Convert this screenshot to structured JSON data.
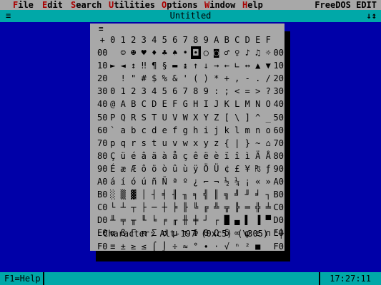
{
  "menu": {
    "items": [
      {
        "hot": "F",
        "rest": "ile"
      },
      {
        "hot": "E",
        "rest": "dit"
      },
      {
        "hot": "S",
        "rest": "earch"
      },
      {
        "hot": "U",
        "rest": "tilities"
      },
      {
        "hot": "O",
        "rest": "ptions"
      },
      {
        "hot": "W",
        "rest": "indow"
      },
      {
        "hot": "H",
        "rest": "elp"
      }
    ],
    "app_name": "FreeDOS EDIT"
  },
  "window": {
    "title": "Untitled",
    "system_box": "≡",
    "scroll_arrows": "↓↕"
  },
  "ascii_dialog": {
    "close_box": "≡",
    "header_row": [
      "+",
      "0",
      "1",
      "2",
      "3",
      "4",
      "5",
      "6",
      "7",
      "8",
      "9",
      "A",
      "B",
      "C",
      "D",
      "E",
      "F"
    ],
    "rows": [
      [
        "00",
        "",
        "☺",
        "☻",
        "♥",
        "♦",
        "♣",
        "♠",
        "•",
        "◘",
        "○",
        "◙",
        "♂",
        "♀",
        "♪",
        "♫",
        "☼"
      ],
      [
        "10",
        "►",
        "◄",
        "↕",
        "‼",
        "¶",
        "§",
        "▬",
        "↨",
        "↑",
        "↓",
        "→",
        "←",
        "∟",
        "↔",
        "▲",
        "▼"
      ],
      [
        "20",
        " ",
        "!",
        "\"",
        "#",
        "$",
        "%",
        "&",
        "'",
        "(",
        ")",
        "*",
        "+",
        ",",
        "-",
        ".",
        "/"
      ],
      [
        "30",
        "0",
        "1",
        "2",
        "3",
        "4",
        "5",
        "6",
        "7",
        "8",
        "9",
        ":",
        ";",
        "<",
        "=",
        ">",
        "?"
      ],
      [
        "40",
        "@",
        "A",
        "B",
        "C",
        "D",
        "E",
        "F",
        "G",
        "H",
        "I",
        "J",
        "K",
        "L",
        "M",
        "N",
        "O"
      ],
      [
        "50",
        "P",
        "Q",
        "R",
        "S",
        "T",
        "U",
        "V",
        "W",
        "X",
        "Y",
        "Z",
        "[",
        "\\",
        "]",
        "^",
        "_"
      ],
      [
        "60",
        "`",
        "a",
        "b",
        "c",
        "d",
        "e",
        "f",
        "g",
        "h",
        "i",
        "j",
        "k",
        "l",
        "m",
        "n",
        "o"
      ],
      [
        "70",
        "p",
        "q",
        "r",
        "s",
        "t",
        "u",
        "v",
        "w",
        "x",
        "y",
        "z",
        "{",
        "|",
        "}",
        "~",
        "⌂"
      ],
      [
        "80",
        "Ç",
        "ü",
        "é",
        "â",
        "ä",
        "à",
        "å",
        "ç",
        "ê",
        "ë",
        "è",
        "ï",
        "î",
        "ì",
        "Ä",
        "Å"
      ],
      [
        "90",
        "É",
        "æ",
        "Æ",
        "ô",
        "ö",
        "ò",
        "û",
        "ù",
        "ÿ",
        "Ö",
        "Ü",
        "¢",
        "£",
        "¥",
        "₧",
        "ƒ"
      ],
      [
        "A0",
        "á",
        "í",
        "ó",
        "ú",
        "ñ",
        "Ñ",
        "ª",
        "º",
        "¿",
        "⌐",
        "¬",
        "½",
        "¼",
        "¡",
        "«",
        "»"
      ],
      [
        "B0",
        "░",
        "▒",
        "▓",
        "│",
        "┤",
        "╡",
        "╢",
        "╖",
        "╕",
        "╣",
        "║",
        "╗",
        "╝",
        "╜",
        "╛",
        "┐"
      ],
      [
        "C0",
        "└",
        "┴",
        "┬",
        "├",
        "─",
        "┼",
        "╞",
        "╟",
        "╚",
        "╔",
        "╩",
        "╦",
        "╠",
        "═",
        "╬",
        "╧"
      ],
      [
        "D0",
        "╨",
        "╤",
        "╥",
        "╙",
        "╘",
        "╒",
        "╓",
        "╫",
        "╪",
        "┘",
        "┌",
        "█",
        "▄",
        "▌",
        "▐",
        "▀"
      ],
      [
        "E0",
        "α",
        "ß",
        "Γ",
        "π",
        "Σ",
        "σ",
        "µ",
        "τ",
        "Φ",
        "Θ",
        "Ω",
        "δ",
        "∞",
        "φ",
        "ε",
        "∩"
      ],
      [
        "F0",
        "≡",
        "±",
        "≥",
        "≤",
        "⌠",
        "⌡",
        "÷",
        "≈",
        "°",
        "∙",
        "·",
        "√",
        "ⁿ",
        "²",
        "■",
        " "
      ]
    ],
    "row_end_labels": [
      "00",
      "10",
      "20",
      "30",
      "40",
      "50",
      "60",
      "70",
      "80",
      "90",
      "A0",
      "B0",
      "C0",
      "D0",
      "E0",
      "F0"
    ],
    "selected": {
      "row": 0,
      "col": 9
    },
    "character_line": "Character: Alt-197 (0xc5) (\\305) '┼'"
  },
  "status": {
    "help": "F1=Help",
    "clock": "17:27:11"
  }
}
